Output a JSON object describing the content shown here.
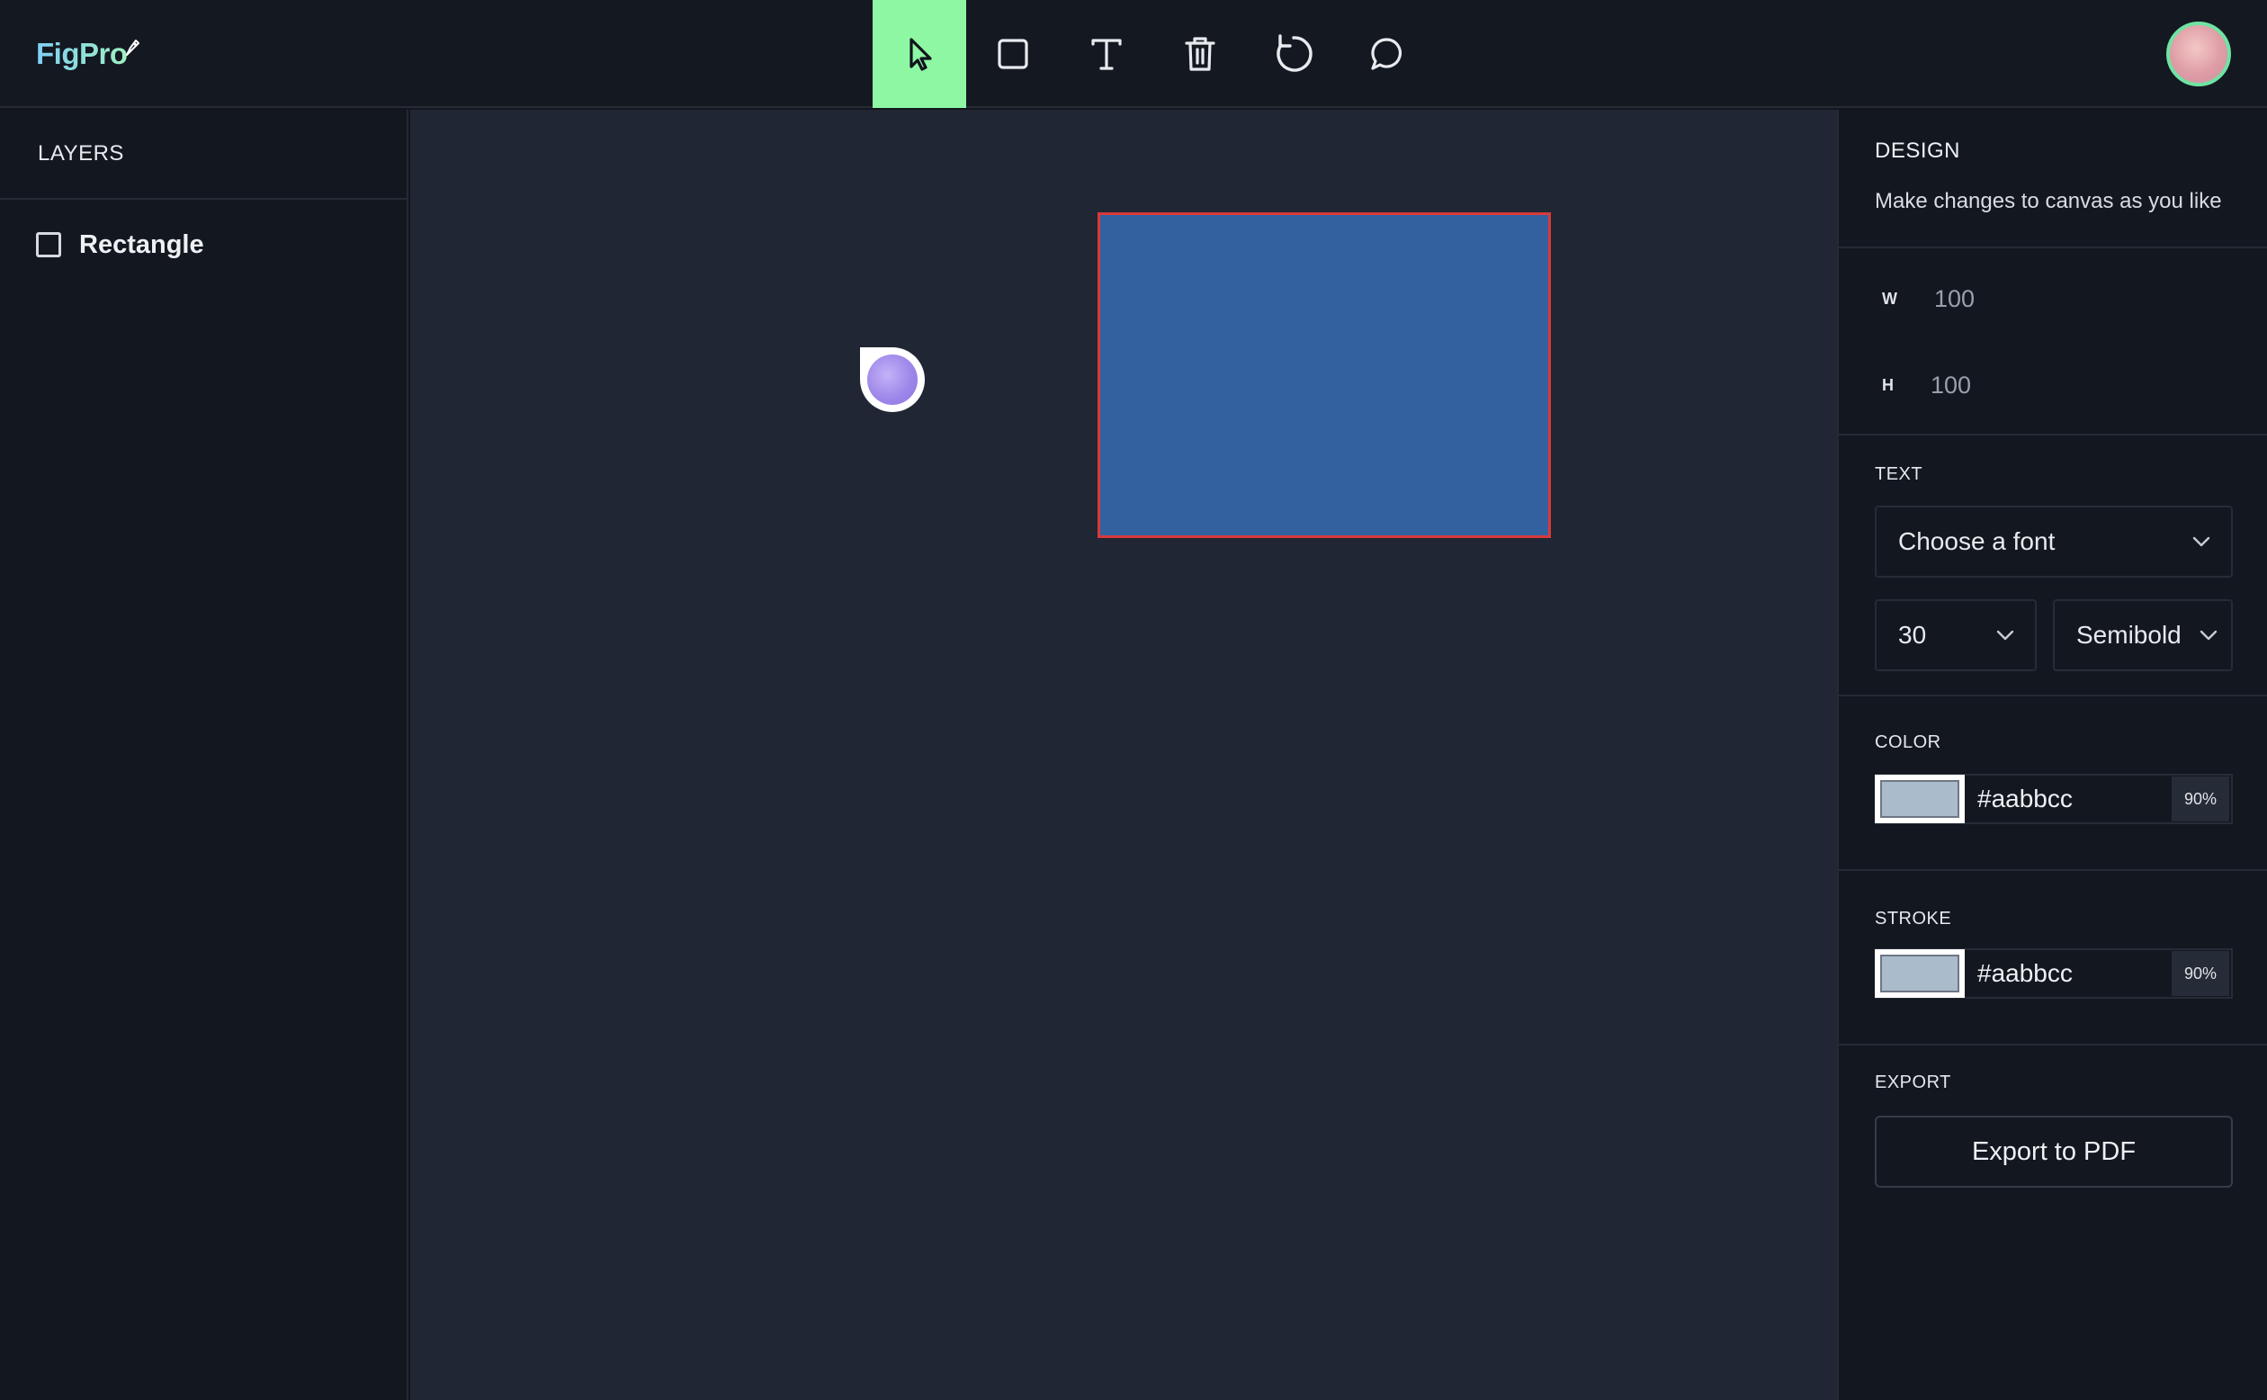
{
  "app": {
    "logo_text": "FigPro"
  },
  "toolbar": {
    "tools": [
      {
        "name": "select",
        "icon": "cursor-icon",
        "active": true
      },
      {
        "name": "rectangle",
        "icon": "square-icon",
        "active": false
      },
      {
        "name": "text",
        "icon": "text-icon",
        "active": false
      },
      {
        "name": "delete",
        "icon": "trash-icon",
        "active": false
      },
      {
        "name": "reset",
        "icon": "rotate-icon",
        "active": false
      },
      {
        "name": "comments",
        "icon": "comment-icon",
        "active": false
      }
    ],
    "active_color": "#8df7a4"
  },
  "layers": {
    "title": "LAYERS",
    "items": [
      {
        "label": "Rectangle",
        "icon": "square-icon"
      }
    ]
  },
  "canvas": {
    "background": "#202633",
    "rectangle_fill": "#3361a0",
    "rectangle_stroke": "#d63a3a"
  },
  "design": {
    "title": "DESIGN",
    "subtitle": "Make changes to canvas as you like",
    "width_label": "W",
    "width_value": "100",
    "height_label": "H",
    "height_value": "100"
  },
  "text": {
    "title": "TEXT",
    "font_placeholder": "Choose a font",
    "font_size": "30",
    "font_weight": "Semibold"
  },
  "color": {
    "title": "COLOR",
    "hex": "#aabbcc",
    "opacity": "90%"
  },
  "stroke": {
    "title": "STROKE",
    "hex": "#aabbcc",
    "opacity": "90%"
  },
  "export": {
    "title": "EXPORT",
    "button_label": "Export to PDF"
  }
}
